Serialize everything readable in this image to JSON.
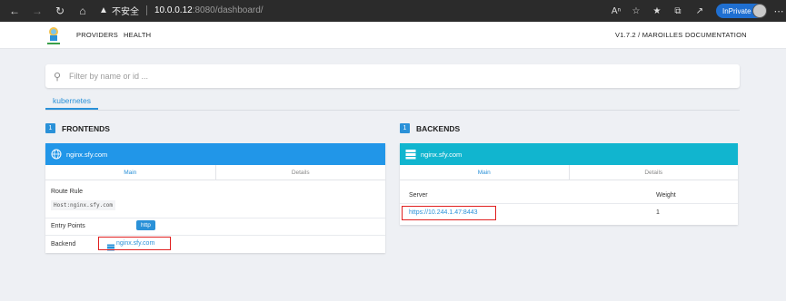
{
  "browser": {
    "security_label": "不安全",
    "url_host": "10.0.0.12",
    "url_path": ":8080/dashboard/",
    "inprivate_label": "InPrivate"
  },
  "nav": {
    "links": [
      "PROVIDERS",
      "HEALTH"
    ],
    "version": "V1.7.2 / MAROILLES",
    "documentation": "DOCUMENTATION"
  },
  "search": {
    "placeholder": "Filter by name or id ..."
  },
  "provider_tab": "kubernetes",
  "frontends": {
    "count": "1",
    "title": "FRONTENDS",
    "name": "nginx.sfy.com",
    "tabs": [
      "Main",
      "Details"
    ],
    "route_rule_label": "Route Rule",
    "route_rule_value": "Host:nginx.sfy.com",
    "entry_points_label": "Entry Points",
    "entry_point": "http",
    "backend_label": "Backend",
    "backend_value": "nginx.sfy.com"
  },
  "backends": {
    "count": "1",
    "title": "BACKENDS",
    "name": "nginx.sfy.com",
    "tabs": [
      "Main",
      "Details"
    ],
    "server_header": "Server",
    "weight_header": "Weight",
    "server": "https://10.244.1.47:8443",
    "weight": "1"
  },
  "colors": {
    "frontend_header": "#2196e8",
    "backend_header": "#11b5cf",
    "highlight": "#e02020"
  }
}
